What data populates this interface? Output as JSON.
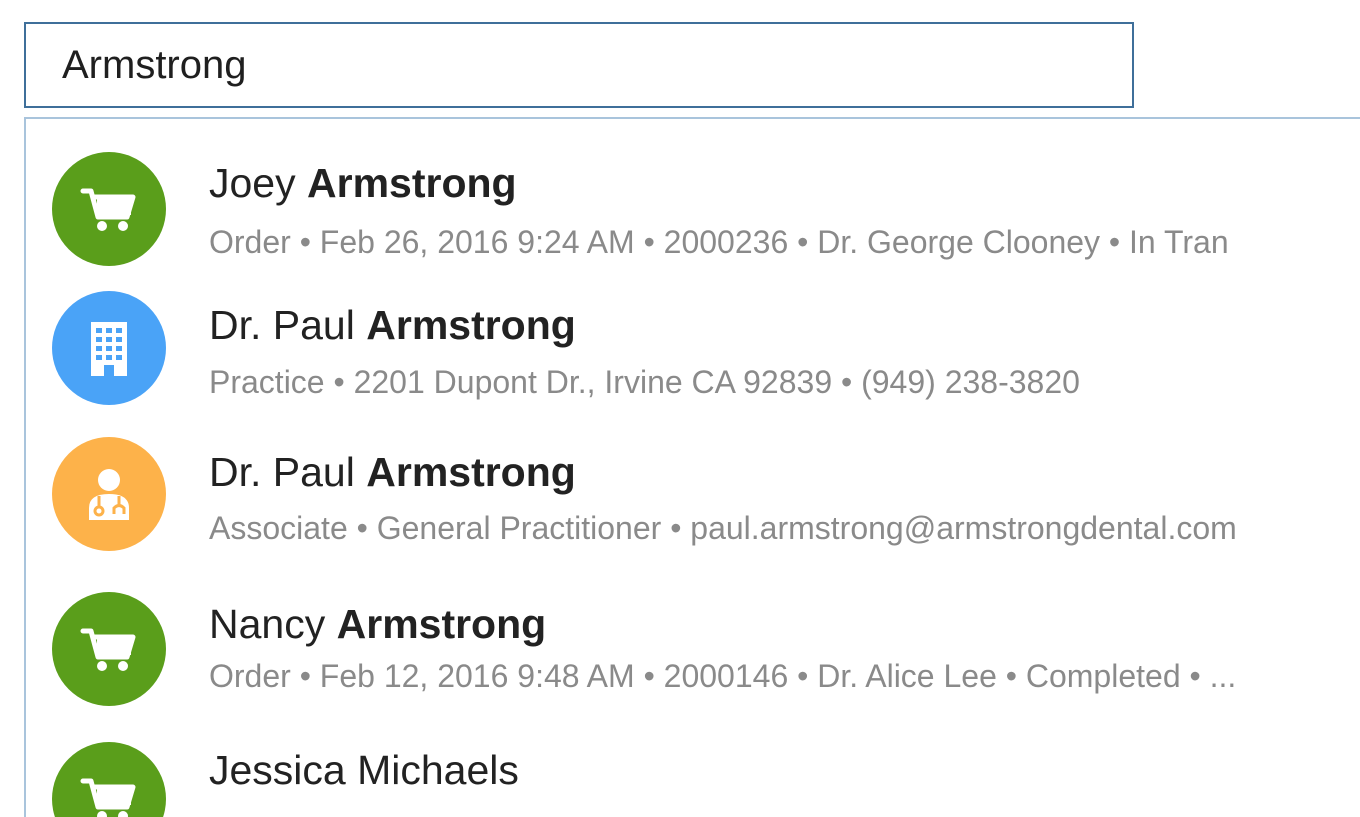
{
  "search": {
    "value": "Armstrong"
  },
  "colors": {
    "order": "#5a9e1b",
    "practice": "#4aa3f7",
    "associate": "#fdb24a",
    "search_border": "#3f6f9a",
    "dropdown_border": "#a9c4dc"
  },
  "results": [
    {
      "icon": "cart-icon",
      "name_prefix": "Joey",
      "name_match": "Armstrong",
      "subtitle": "Order • Feb 26, 2016 9:24 AM • 2000236 • Dr. George Clooney • In Tran"
    },
    {
      "icon": "building-icon",
      "name_prefix": "Dr. Paul",
      "name_match": "Armstrong",
      "subtitle": "Practice • 2201 Dupont Dr., Irvine CA 92839 • (949) 238-3820"
    },
    {
      "icon": "doctor-icon",
      "name_prefix": "Dr. Paul",
      "name_match": "Armstrong",
      "subtitle": "Associate • General Practitioner • paul.armstrong@armstrongdental.com"
    },
    {
      "icon": "cart-icon",
      "name_prefix": "Nancy",
      "name_match": "Armstrong",
      "subtitle": "Order • Feb 12, 2016 9:48 AM • 2000146 • Dr. Alice Lee • Completed • ..."
    },
    {
      "icon": "cart-icon",
      "name_prefix": "Jessica Michaels",
      "name_match": "",
      "subtitle": ""
    }
  ]
}
